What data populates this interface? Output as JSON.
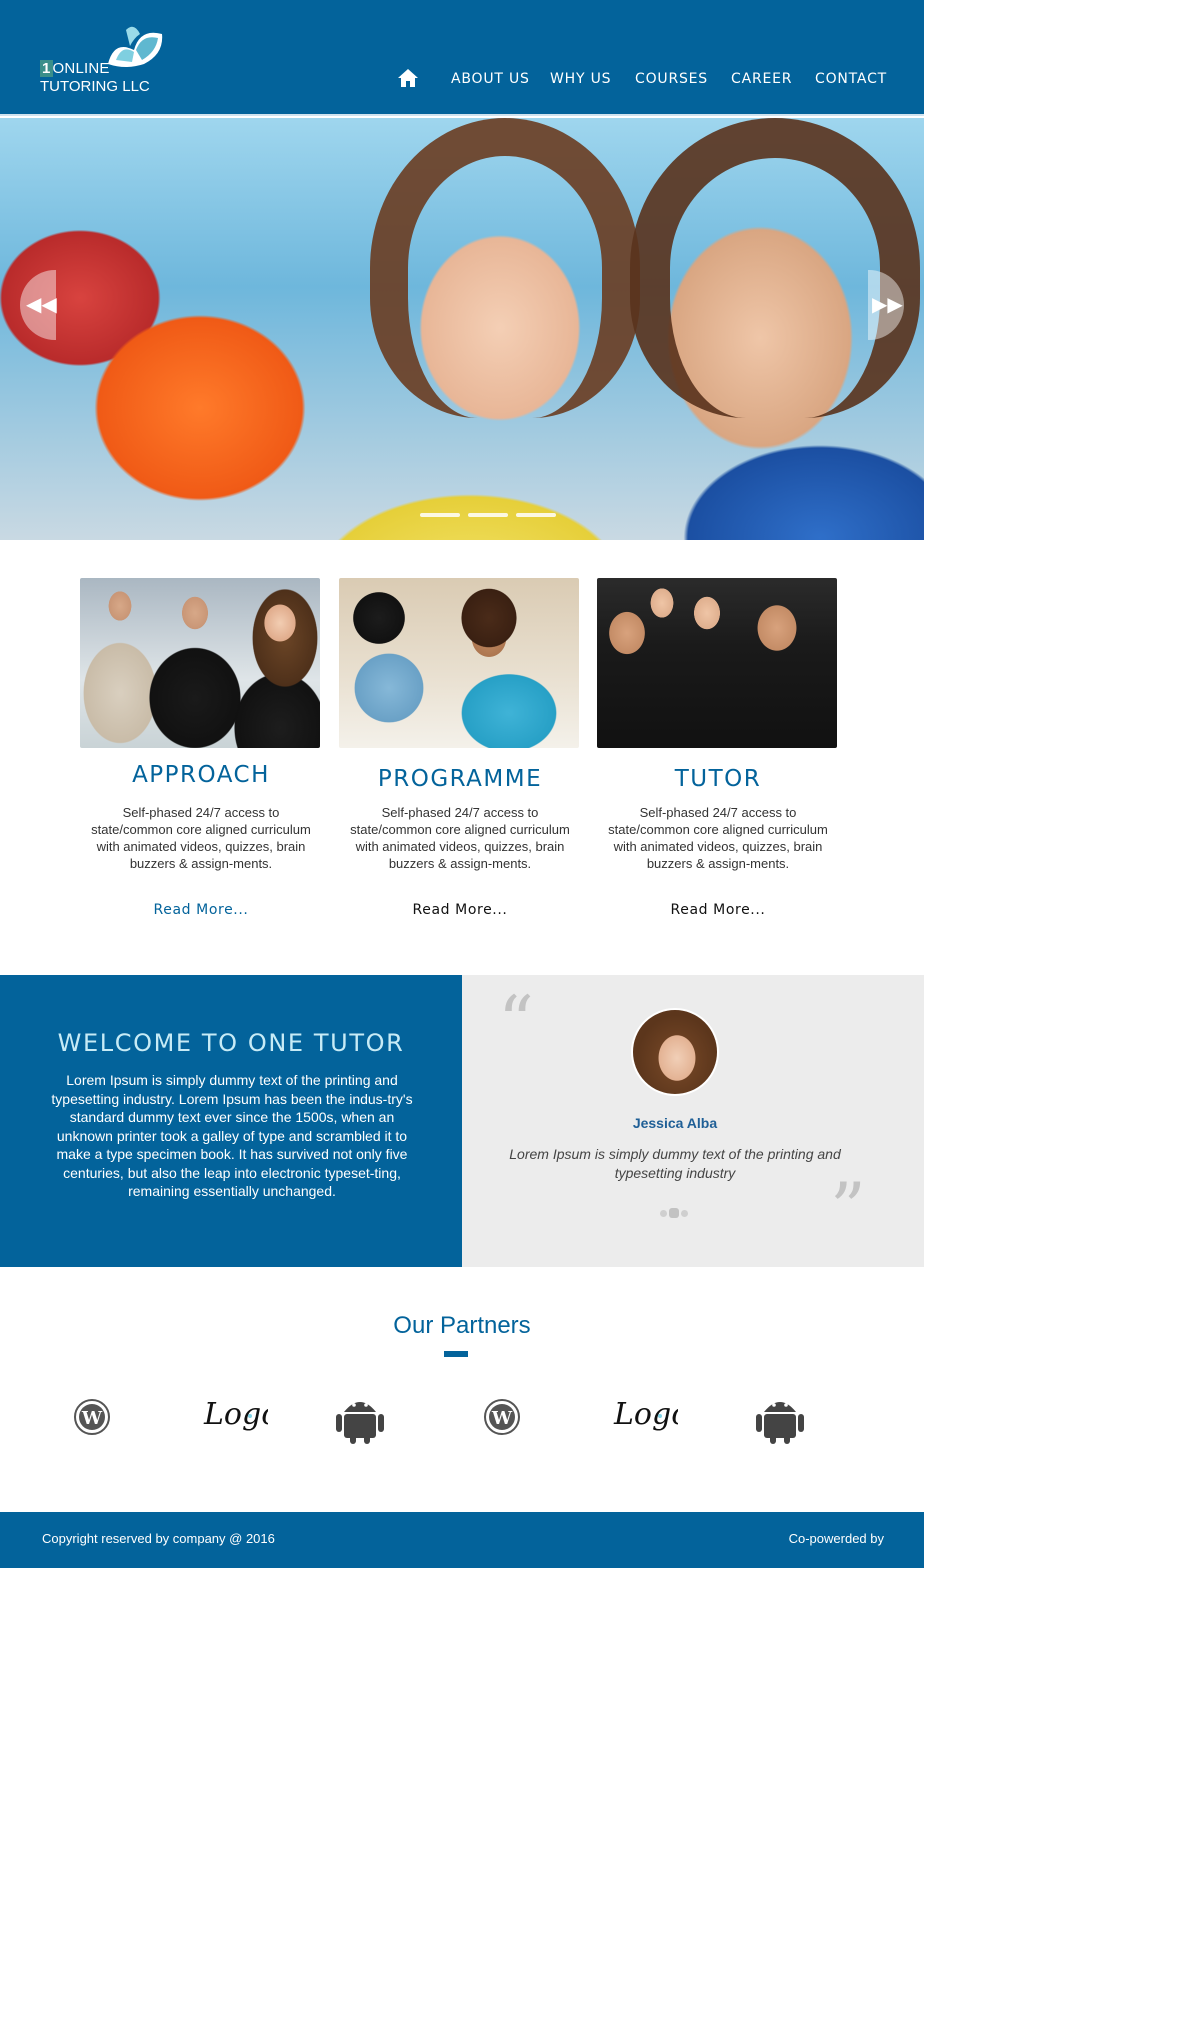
{
  "brand": {
    "logo_line1_num": "1",
    "logo_line1": "ONLINE",
    "logo_line2": "TUTORING LLC",
    "primary_color": "#03639b",
    "accent_color": "#c7ebf6"
  },
  "nav": {
    "home_icon": "home-icon",
    "items": [
      "ABOUT US",
      "WHY US",
      "COURSES",
      "CAREER",
      "CONTACT"
    ]
  },
  "hero": {
    "prev_icon": "◀◀",
    "next_icon": "▶▶",
    "slide_count": 3,
    "active_slide": 1
  },
  "features": [
    {
      "title": "APPROACH",
      "description": "Self-phased 24/7 access to state/common core aligned curriculum with animated videos, quizzes, brain buzzers & assign-ments.",
      "link": "Read More...",
      "image": "business-people-photo"
    },
    {
      "title": "PROGRAMME",
      "description": "Self-phased 24/7 access to state/common core aligned curriculum with animated videos, quizzes, brain buzzers & assign-ments.",
      "link": "Read More...",
      "image": "kids-writing-photo"
    },
    {
      "title": "TUTOR",
      "description": "Self-phased 24/7 access to state/common core aligned curriculum with animated videos, quizzes, brain buzzers & assign-ments.",
      "link": "Read More...",
      "image": "graduates-photo"
    }
  ],
  "welcome": {
    "title": "WELCOME TO ONE TUTOR",
    "text": "Lorem Ipsum is simply dummy text of the printing and typesetting industry. Lorem Ipsum has been the indus-try's standard dummy text ever since the 1500s, when an unknown printer took a galley of type and scrambled it to make a type specimen book. It has survived not only five centuries, but also the leap into electronic typeset-ting, remaining essentially unchanged."
  },
  "testimonial": {
    "quote_open": "“",
    "quote_close": "”",
    "name": "Jessica Alba",
    "text": "Lorem Ipsum is simply dummy text of the printing and typesetting industry"
  },
  "partners": {
    "title": "Our Partners",
    "logos": [
      "wordpress-icon",
      "logo-wordmark",
      "android-icon",
      "wordpress-icon",
      "logo-wordmark",
      "android-icon"
    ],
    "logo_text": "Logo"
  },
  "footer": {
    "copyright": "Copyright reserved by company @ 2016",
    "powered": "Co-powerded by"
  }
}
